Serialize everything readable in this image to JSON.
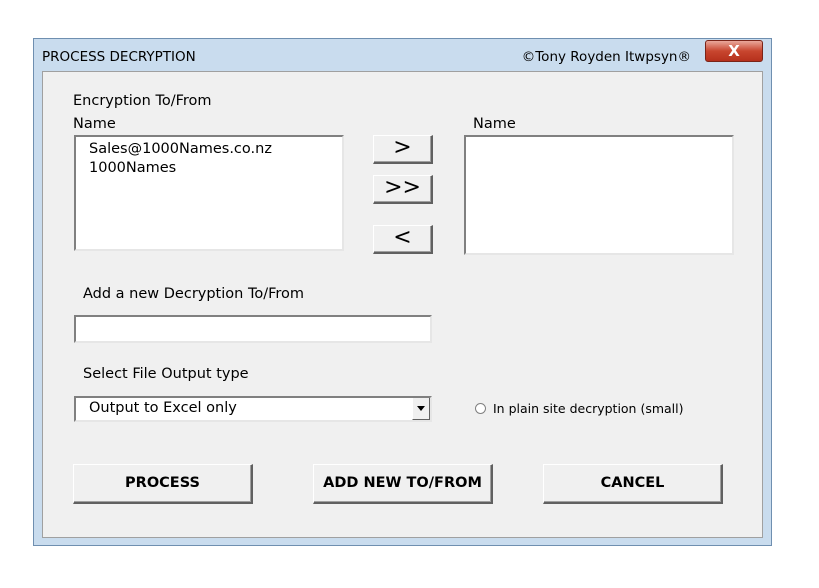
{
  "window": {
    "title": "PROCESS DECRYPTION",
    "copyright": "©Tony Royden Itwpsyn®",
    "close_label": "X"
  },
  "encryption": {
    "section_label": "Encryption To/From",
    "left_header": "Name",
    "right_header": "Name",
    "left_items": [
      "Sales@1000Names.co.nz",
      "1000Names"
    ],
    "right_items": []
  },
  "buttons": {
    "move_one_right": ">",
    "move_all_right": ">>",
    "move_one_left": "<",
    "process": "PROCESS",
    "add_new": "ADD NEW TO/FROM",
    "cancel": "CANCEL"
  },
  "add_new": {
    "label": "Add a new Decryption To/From",
    "value": ""
  },
  "output": {
    "label": "Select File Output type",
    "selected": "Output to Excel only",
    "radio_label": "In plain site decryption (small)",
    "radio_checked": false
  }
}
